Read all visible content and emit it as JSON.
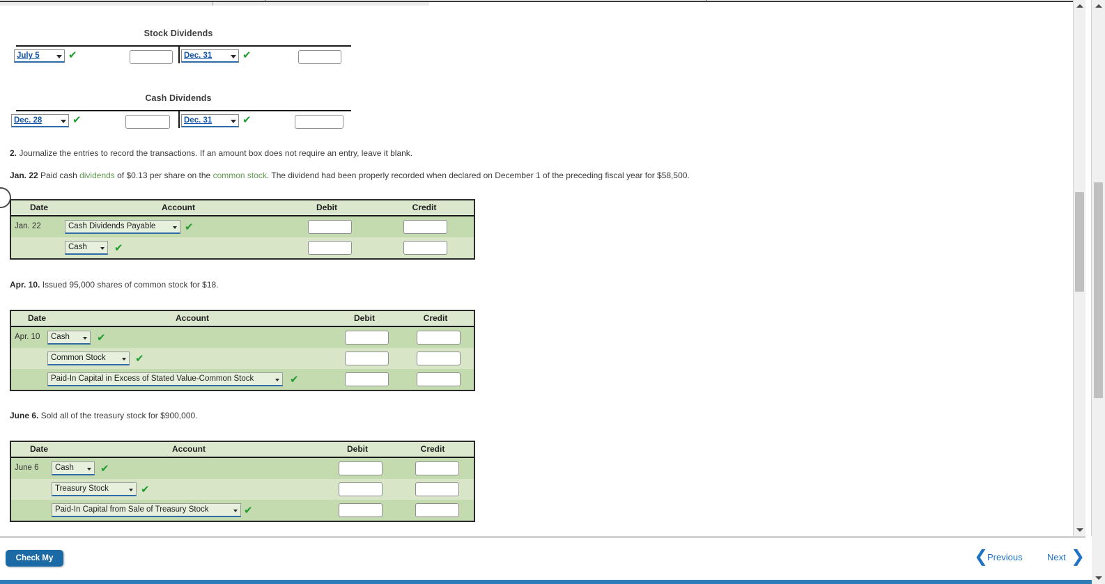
{
  "taccounts": [
    {
      "title": "Stock Dividends",
      "left_date": "July 5",
      "right_date": "Dec. 31",
      "left_amount": "",
      "right_amount": ""
    },
    {
      "title": "Cash Dividends",
      "left_date": "Dec. 28",
      "right_date": "Dec. 31",
      "left_amount": "",
      "right_amount": ""
    }
  ],
  "instructions": {
    "step2_number": "2.",
    "step2_text": "Journalize the entries to record the transactions. If an amount box does not require an entry, leave it blank."
  },
  "transactions": [
    {
      "date_label": "Jan. 22",
      "desc_pre": "Paid cash ",
      "desc_term1": "dividends",
      "desc_mid": " of $0.13 per share on the ",
      "desc_term2": "common stock",
      "desc_post": ". The dividend had been properly recorded when declared on December 1 of the preceding fiscal year for $58,500.",
      "table": {
        "headers": [
          "Date",
          "Account",
          "Debit",
          "Credit"
        ],
        "rows": [
          {
            "date": "Jan. 22",
            "account": "Cash Dividends Payable",
            "debit": "",
            "credit": "",
            "checked": true
          },
          {
            "date": "",
            "account": "Cash",
            "debit": "",
            "credit": "",
            "checked": true
          }
        ]
      }
    },
    {
      "date_label": "Apr. 10.",
      "desc_plain": "Issued 95,000 shares of common stock for $18.",
      "table": {
        "headers": [
          "Date",
          "Account",
          "Debit",
          "Credit"
        ],
        "rows": [
          {
            "date": "Apr. 10",
            "account": "Cash",
            "debit": "",
            "credit": "",
            "checked": true
          },
          {
            "date": "",
            "account": "Common Stock",
            "debit": "",
            "credit": "",
            "checked": true
          },
          {
            "date": "",
            "account": "Paid-In Capital in Excess of Stated Value-Common Stock",
            "debit": "",
            "credit": "",
            "checked": true
          }
        ]
      }
    },
    {
      "date_label": "June 6.",
      "desc_plain": "Sold all of the treasury stock for $900,000.",
      "table": {
        "headers": [
          "Date",
          "Account",
          "Debit",
          "Credit"
        ],
        "rows": [
          {
            "date": "June 6",
            "account": "Cash",
            "debit": "",
            "credit": "",
            "checked": true
          },
          {
            "date": "",
            "account": "Treasury Stock",
            "debit": "",
            "credit": "",
            "checked": true
          },
          {
            "date": "",
            "account": "Paid-In Capital from Sale of Treasury Stock",
            "debit": "",
            "credit": "",
            "checked": true
          }
        ]
      }
    }
  ],
  "footer": {
    "check_my_work": "Check My Work",
    "previous": "Previous",
    "next": "Next",
    "prev_chevron": "❮",
    "next_chevron": "❯"
  },
  "icons": {
    "check": "✔"
  },
  "colors": {
    "accent_blue": "#1b6aa5",
    "link_blue": "#1f72c4",
    "check_green": "#1f9c2e",
    "table_header_green": "#dce8cd",
    "row_green_a": "#c4daaf",
    "row_green_b": "#d8e6c7"
  }
}
